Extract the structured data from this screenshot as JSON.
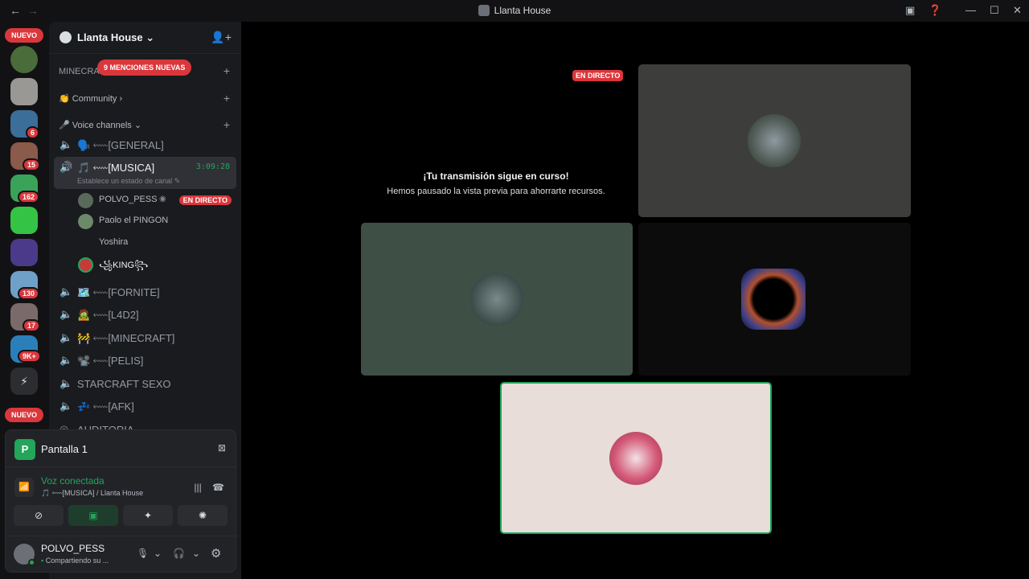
{
  "window": {
    "title": "Llanta House",
    "back_icon": "arrow-left",
    "forward_icon": "arrow-right",
    "controls": [
      "inbox-icon",
      "help-icon",
      "minimize",
      "maximize",
      "close"
    ]
  },
  "servers": {
    "nuevo_top": "NUEVO",
    "nuevo_bottom": "NUEVO",
    "badges": [
      "6",
      "15",
      "162",
      "130",
      "17",
      "9K+"
    ]
  },
  "guild": {
    "name": "Llanta House",
    "mentions_pill": "9 MENCIONES NUEVAS",
    "categories": {
      "minecraft": "MINECRA",
      "community": "Community",
      "voice": "Voice channels"
    },
    "voice_channels": [
      {
        "label": "🗣️ ⬳[GENERAL]"
      },
      {
        "label": "🎵 ⬳[MUSICA]",
        "timer": "3:09:28",
        "status": "Establece un estado de canal"
      },
      {
        "label": "🗺️ ⬳[FORNITE]"
      },
      {
        "label": "🧟 ⬳[L4D2]"
      },
      {
        "label": "🚧 ⬳[MINECRAFT]"
      },
      {
        "label": "📽️ ⬳[PELIS]"
      },
      {
        "label": "STARCRAFT SEXO"
      },
      {
        "label": "💤 ⬳[AFK]"
      },
      {
        "label": "AUDITORIA"
      }
    ],
    "members": [
      {
        "name": "POLVO_PESS",
        "live": "EN DIRECTO"
      },
      {
        "name": "Paolo el PINGON"
      },
      {
        "name": "Yoshira"
      },
      {
        "name": "꧁KING꧂"
      }
    ]
  },
  "panel": {
    "screen_label": "Pantalla 1",
    "voice_title": "Voz conectada",
    "voice_sub": "🎵 ⬳[MUSICA] / Llanta House",
    "user_name": "POLVO_PESS",
    "user_status": "Compartiendo su ..."
  },
  "stage": {
    "live_badge": "EN DIRECTO",
    "paused_title": "¡Tu transmisión sigue en curso!",
    "paused_sub": "Hemos pausado la vista previa para ahorrarte recursos."
  },
  "colors": {
    "accent_green": "#23a55a",
    "danger_red": "#da373c",
    "tile_gray": "#3d3e3b",
    "tile_green": "#3e4f46",
    "tile_pink": "#e8ddd8"
  }
}
